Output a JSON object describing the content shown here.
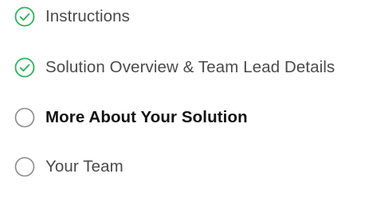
{
  "steps": [
    {
      "label": "Instructions",
      "state": "complete",
      "icon": "check-circle-icon"
    },
    {
      "label": "Solution Overview & Team Lead Details",
      "state": "complete",
      "icon": "check-circle-icon"
    },
    {
      "label": "More About Your Solution",
      "state": "current",
      "icon": "empty-circle-icon"
    },
    {
      "label": "Your Team",
      "state": "incomplete",
      "icon": "empty-circle-icon"
    }
  ],
  "colors": {
    "complete": "#2fb35a",
    "incomplete_ring": "#8a8a8a",
    "current_text": "#111111",
    "default_text": "#4a4a4a"
  }
}
